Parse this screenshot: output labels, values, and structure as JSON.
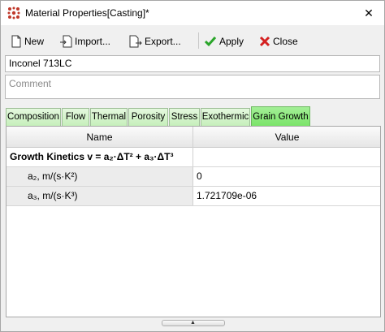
{
  "window": {
    "title": "Material Properties[Casting]*",
    "close_glyph": "✕"
  },
  "toolbar": {
    "new_label": "New",
    "import_label": "Import...",
    "export_label": "Export...",
    "apply_label": "Apply",
    "close_label": "Close"
  },
  "material_name": "Inconel 713LC",
  "comment_placeholder": "Comment",
  "tabs": [
    {
      "label": "Composition"
    },
    {
      "label": "Flow"
    },
    {
      "label": "Thermal"
    },
    {
      "label": "Porosity"
    },
    {
      "label": "Stress"
    },
    {
      "label": "Exothermic"
    },
    {
      "label": "Grain Growth",
      "active": true
    }
  ],
  "table": {
    "headers": {
      "name": "Name",
      "value": "Value"
    },
    "rows": [
      {
        "name": "Growth Kinetics v = a₂·ΔT² + a₃·ΔT³",
        "value": "",
        "type": "group"
      },
      {
        "name": "a₂, m/(s·K²)",
        "value": "0",
        "type": "param"
      },
      {
        "name": "a₃, m/(s·K³)",
        "value": "1.721709e-06",
        "type": "param"
      }
    ]
  },
  "splitter_glyph": "▲",
  "colors": {
    "tab_active": "#7be46a",
    "tab_inactive": "#c6efbb",
    "apply_check": "#2aa52a",
    "close_x": "#d42020",
    "title_icon": "#c0392b"
  }
}
